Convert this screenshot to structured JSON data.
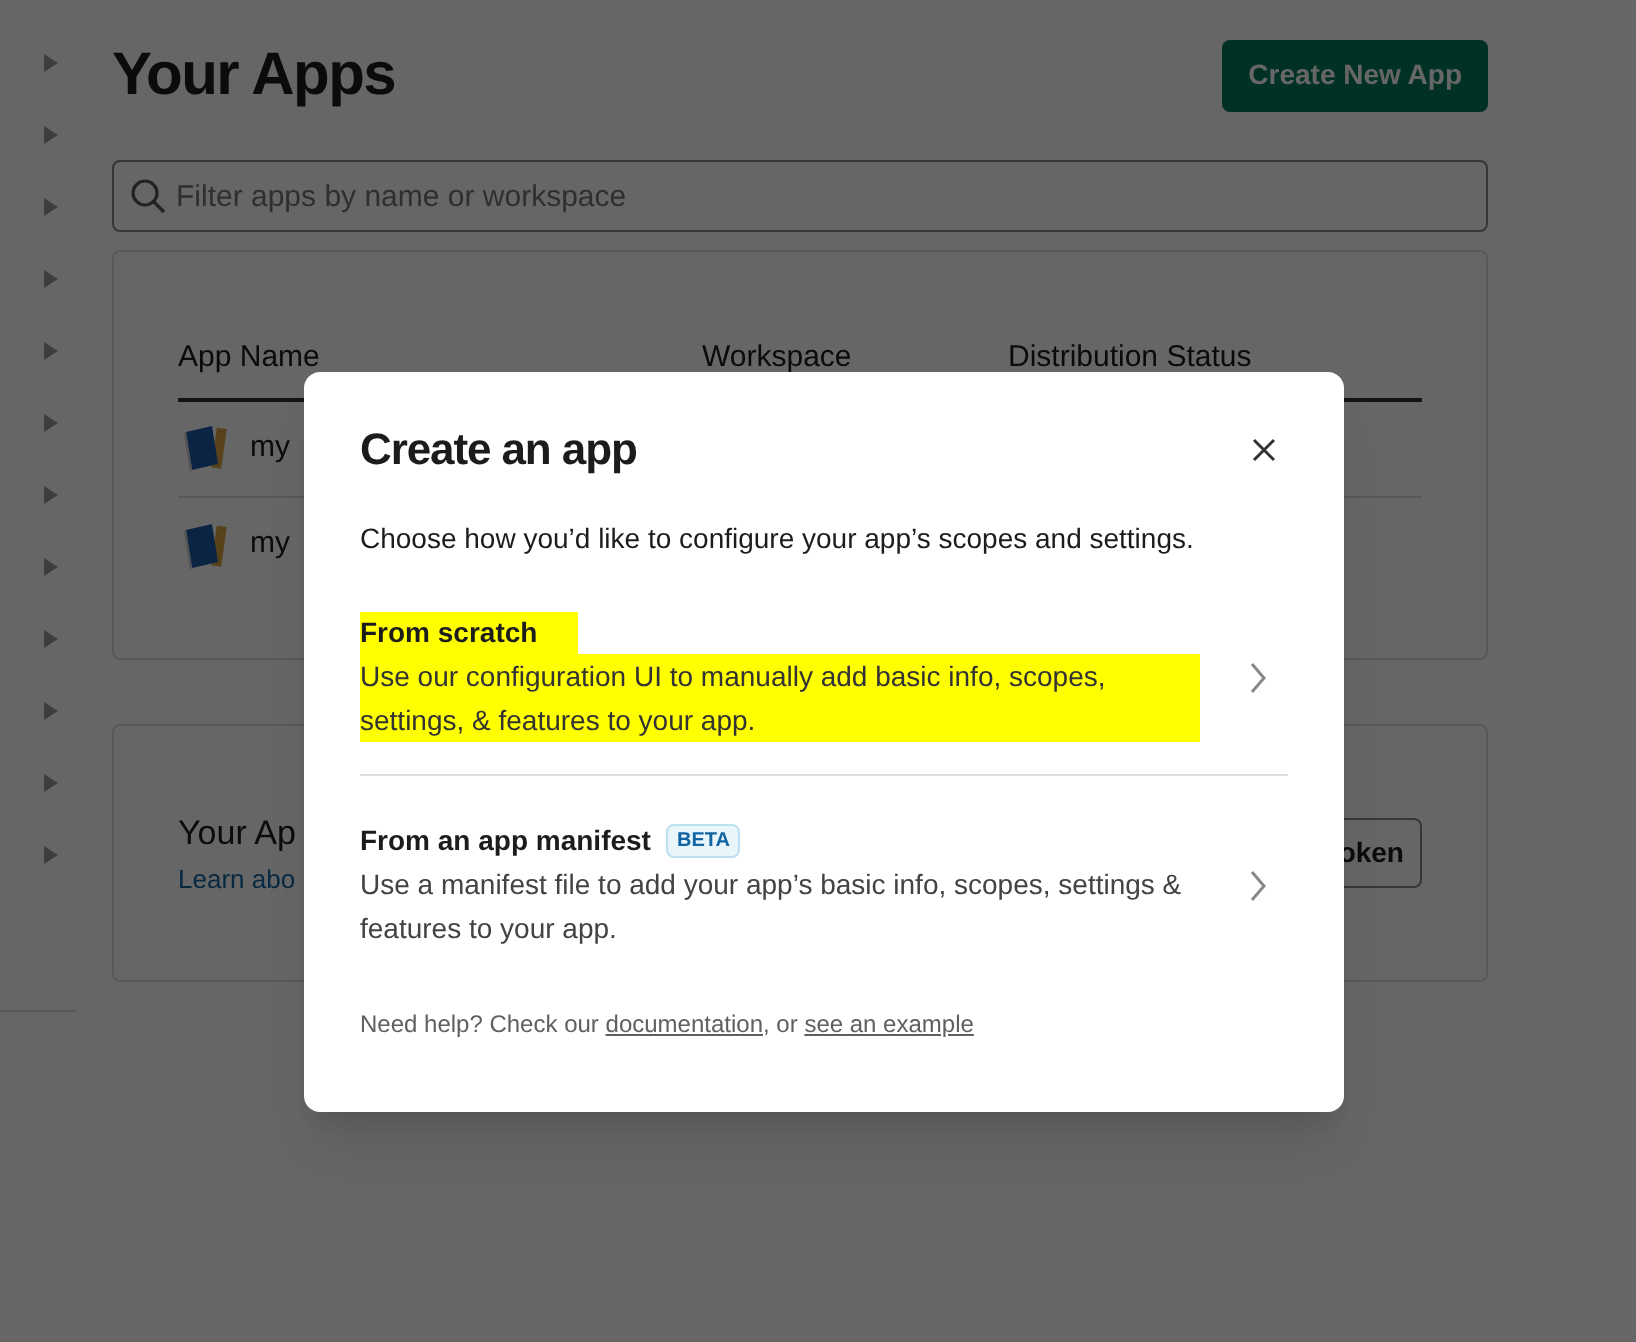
{
  "page": {
    "title": "Your Apps",
    "create_button": "Create New App",
    "search": {
      "placeholder": "Filter apps by name or workspace"
    }
  },
  "apps_table": {
    "columns": [
      "App Name",
      "Workspace",
      "Distribution Status"
    ],
    "rows": [
      {
        "app_name": "my"
      },
      {
        "app_name": "my"
      }
    ]
  },
  "tokens_card": {
    "title": "Your Ap",
    "link": "Learn abo",
    "button": "oken"
  },
  "modal": {
    "title": "Create an app",
    "description": "Choose how you’d like to configure your app’s scopes and settings.",
    "options": [
      {
        "title": "From scratch",
        "description": "Use our configuration UI to manually add basic info, scopes, settings, & features to your app.",
        "highlighted": true
      },
      {
        "title": "From an app manifest",
        "badge": "BETA",
        "description": "Use a manifest file to add your app’s basic info, scopes, settings & features to your app.",
        "highlighted": false
      }
    ],
    "footer": {
      "text_1": "Need help? Check our",
      "link_1": "documentation",
      "text_2": ", or",
      "link_2": "see an example"
    }
  }
}
